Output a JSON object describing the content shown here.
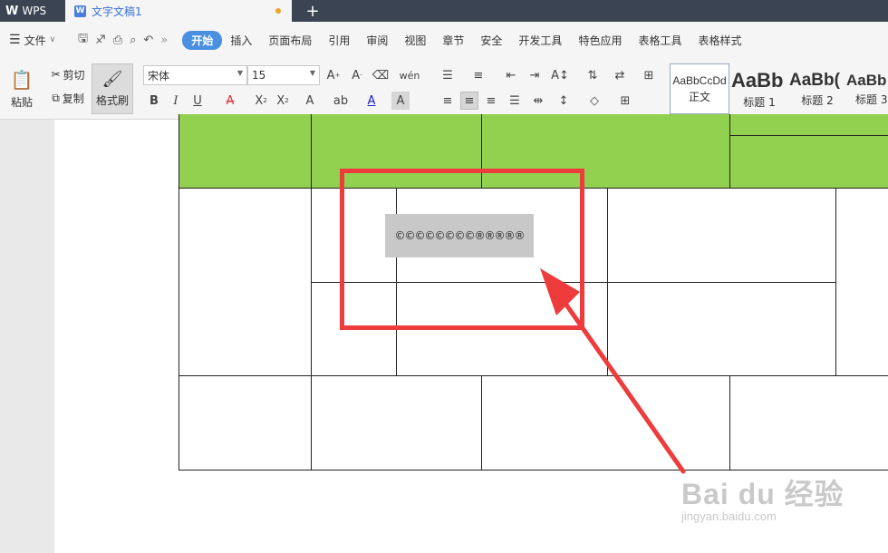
{
  "titlebar": {
    "app": "WPS",
    "doc_tab": "文字文稿1",
    "new_tab": "+"
  },
  "menu": {
    "file": "文件",
    "items": [
      "开始",
      "插入",
      "页面布局",
      "引用",
      "审阅",
      "视图",
      "章节",
      "安全",
      "开发工具",
      "特色应用",
      "表格工具",
      "表格样式"
    ],
    "active_index": 0
  },
  "ribbon": {
    "paste": "粘贴",
    "cut": "剪切",
    "copy": "复制",
    "format_painter": "格式刷",
    "font_name": "宋体",
    "font_size": "15",
    "styles": [
      {
        "sample": "AaBbCcDd",
        "name": "正文"
      },
      {
        "sample": "AaBb",
        "name": "标题 1"
      },
      {
        "sample": "AaBb(",
        "name": "标题 2"
      },
      {
        "sample": "AaBb",
        "name": "标题 3"
      }
    ]
  },
  "document": {
    "selected_text": "©©©©©©©©®®®®®"
  },
  "watermark": {
    "main": "Bai du 经验",
    "sub": "jingyan.baidu.com"
  },
  "colors": {
    "header_green": "#92d050",
    "annotation_red": "#ee3b3b",
    "accent_blue": "#4a90e2"
  }
}
